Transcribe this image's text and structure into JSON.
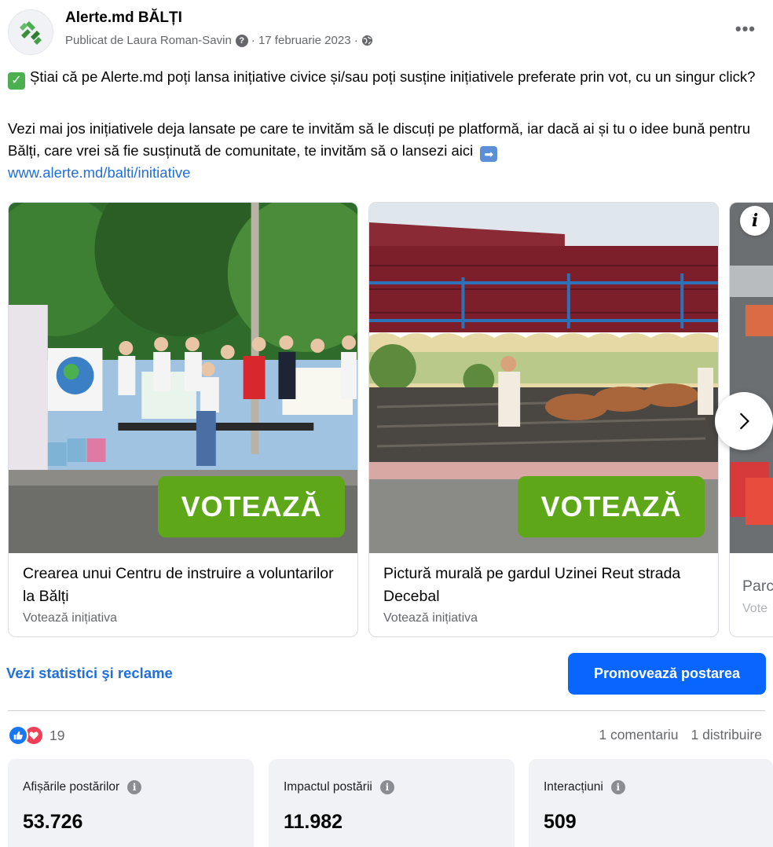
{
  "post": {
    "page_name": "Alerte.md BĂLȚI",
    "published_by": "Publicat de Laura Roman-Savin",
    "date": "· 17 februarie 2023 ·",
    "text_1": "Știai că pe Alerte.md poți lansa inițiative civice și/sau poți susține inițiativele preferate prin vot, cu un singur click?",
    "text_2": "Vezi mai jos inițiativele deja lansate pe care te invităm să le discuți pe platformă, iar dacă ai și tu o idee bună pentru Bălți, care vrei să fie susținută de comunitate, te invităm să o lansezi aici",
    "link": "www.alerte.md/balti/initiative"
  },
  "carousel": {
    "cards": [
      {
        "button": "VOTEAZĂ",
        "title": "Crearea unui Centru de instruire a voluntarilor la Bălți",
        "subtitle": "Votează inițiativa",
        "image_desc": "group-photo"
      },
      {
        "button": "VOTEAZĂ",
        "title": "Pictură murală pe gardul Uzinei Reut strada Decebal",
        "subtitle": "Votează inițiativa",
        "image_desc": "mural-photo"
      },
      {
        "button": "",
        "title": "Parc",
        "subtitle": "Vote",
        "image_desc": "parking-photo"
      }
    ]
  },
  "actions": {
    "stats_link": "Vezi statistici şi reclame",
    "promote_button": "Promovează postarea"
  },
  "engagement": {
    "reaction_count": "19",
    "comments": "1 comentariu",
    "shares": "1 distribuire"
  },
  "metrics": [
    {
      "label": "Afișările postărilor",
      "value": "53.726"
    },
    {
      "label": "Impactul postării",
      "value": "11.982"
    },
    {
      "label": "Interacțiuni",
      "value": "509"
    }
  ],
  "colors": {
    "link": "#216fdb",
    "primary_button": "#0866ff",
    "vote_button": "#5ea719",
    "like": "#1877f2",
    "love": "#f33e58"
  },
  "icons": [
    "page-avatar-icon",
    "question-icon",
    "globe-icon",
    "more-icon",
    "check-icon",
    "arrow-right-icon",
    "info-icon",
    "chevron-right-icon",
    "like-icon",
    "love-icon"
  ]
}
